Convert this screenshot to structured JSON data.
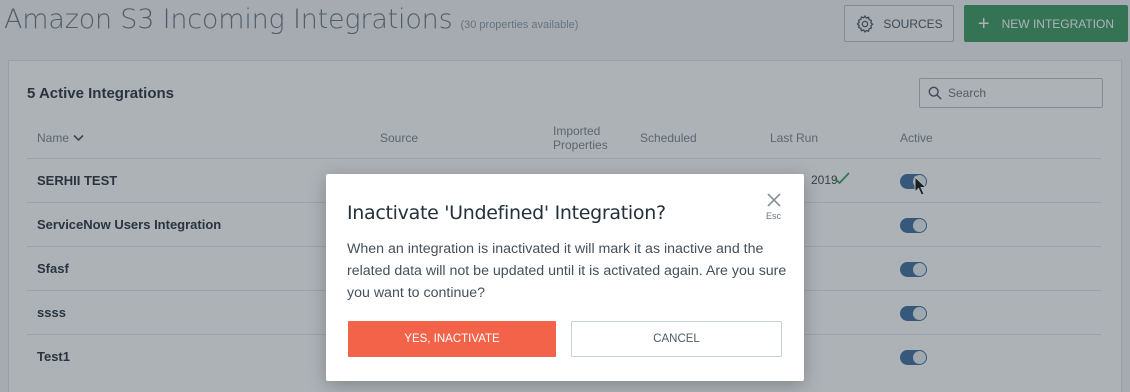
{
  "header": {
    "title": "Amazon S3 Incoming Integrations",
    "subtitle": "(30 properties available)",
    "sources_button": "SOURCES",
    "new_button": "NEW INTEGRATION"
  },
  "card": {
    "title": "5 Active Integrations",
    "search_placeholder": "Search",
    "columns": {
      "name": "Name",
      "source": "Source",
      "imported_line1": "Imported",
      "imported_line2": "Properties",
      "scheduled": "Scheduled",
      "last_run": "Last Run",
      "active": "Active"
    },
    "rows": [
      {
        "name": "SERHII TEST",
        "last_run": "2019",
        "active": true
      },
      {
        "name": "ServiceNow Users Integration",
        "active": true
      },
      {
        "name": "Sfasf",
        "active": true
      },
      {
        "name": "ssss",
        "active": true
      },
      {
        "name": "Test1",
        "active": true
      }
    ]
  },
  "modal": {
    "title": "Inactivate 'Undefined' Integration?",
    "esc_label": "Esc",
    "body": "When an integration is inactivated it will mark it as inactive and the related data will not be updated until it is activated again. Are you sure you want to continue?",
    "confirm_label": "YES, INACTIVATE",
    "cancel_label": "CANCEL"
  },
  "colors": {
    "accent_green": "#3c9a5f",
    "danger": "#f2634a",
    "toggle_on": "#3f6e9e"
  },
  "icons": {
    "sources": "gear-icon",
    "new": "plus-icon",
    "search": "search-icon",
    "sort": "chevron-down-icon",
    "success": "check-icon",
    "close": "close-icon",
    "pointer": "cursor-icon"
  }
}
